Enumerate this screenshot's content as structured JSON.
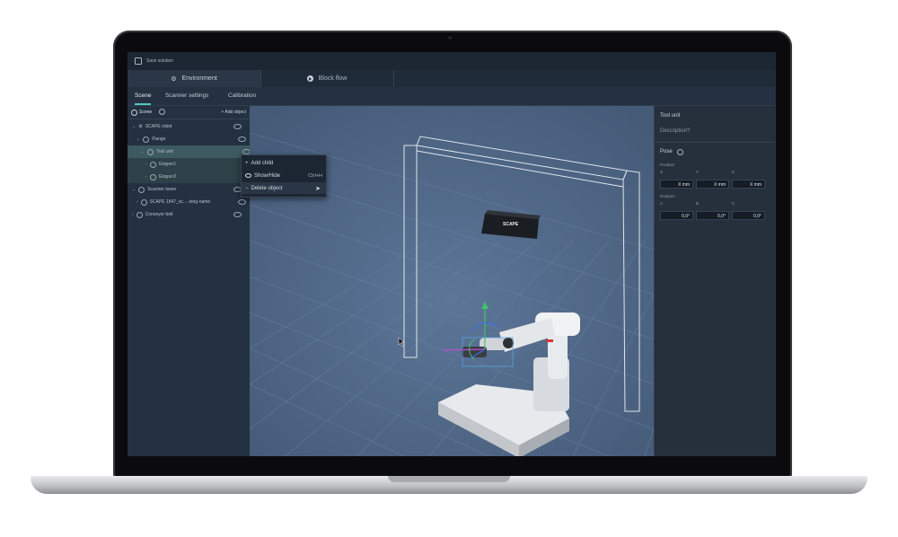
{
  "topbar": {
    "save_label": "Save solution"
  },
  "tabs": {
    "environment": "Environment",
    "block_flow": "Block flow"
  },
  "subtabs": {
    "scene": "Scene",
    "scanner_settings": "Scanner settings",
    "calibration": "Calibration"
  },
  "scene": {
    "title": "Scene",
    "add_object": "Add object",
    "items": [
      {
        "label": "SCAPE robot"
      },
      {
        "label": "Flange"
      },
      {
        "label": "Tool unit"
      },
      {
        "label": "Gripper1"
      },
      {
        "label": "Gripper2"
      },
      {
        "label": "Scanner tower"
      },
      {
        "label": "SCAPE 1847_sc…-long-name"
      },
      {
        "label": "Conveyor belt"
      }
    ]
  },
  "context_menu": {
    "add_child": "Add child",
    "show_hide": "Show/Hide",
    "show_hide_shortcut": "Ctrl+H",
    "delete_object": "Delete object"
  },
  "viewport": {
    "scanner_label": "SCAPE"
  },
  "properties": {
    "title": "Tool unit",
    "description_placeholder": "Description?",
    "pose_label": "Pose",
    "position_label": "Position",
    "rotation_label": "Rotation",
    "axes_pos": [
      "X",
      "Y",
      "Z"
    ],
    "axes_rot": [
      "A",
      "B",
      "C"
    ],
    "position_values": [
      "X mm",
      "X mm",
      "X mm"
    ],
    "rotation_values": [
      "0,0°",
      "0,0°",
      "0,0°"
    ]
  },
  "colors": {
    "accent": "#52c7c0",
    "viewport": "#4e6685"
  }
}
